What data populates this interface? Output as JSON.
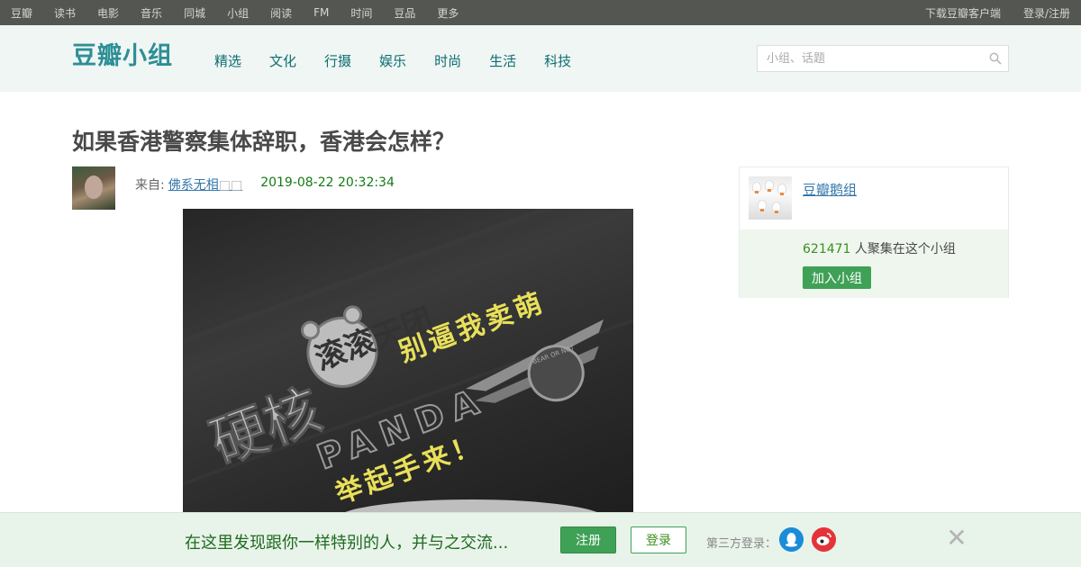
{
  "global_nav": {
    "left": [
      "豆瓣",
      "读书",
      "电影",
      "音乐",
      "同城",
      "小组",
      "阅读",
      "FM",
      "时间",
      "豆品",
      "更多"
    ],
    "right": [
      "下载豆瓣客户端",
      "登录/注册"
    ]
  },
  "header": {
    "logo": "豆瓣小组",
    "nav": [
      "精选",
      "文化",
      "行摄",
      "娱乐",
      "时尚",
      "生活",
      "科技"
    ],
    "search_placeholder": "小组、话题"
  },
  "article": {
    "title": "如果香港警察集体辞职，香港会怎样？",
    "from_label": "来自:",
    "author": "佛系无相",
    "author_suffix": "□□",
    "time": "2019-08-22 20:32:34",
    "image_text": {
      "line1": "滚滚天团",
      "line2": "硬核",
      "line3": "PANDA",
      "line4": "别逼我卖萌",
      "line5": "举起手来！",
      "badge": "BEAR OR NOT"
    }
  },
  "group_card": {
    "name": "豆瓣鹅组",
    "member_count": "621471",
    "member_text": " 人聚集在这个小组",
    "join_label": "加入小组"
  },
  "banner": {
    "text": "在这里发现跟你一样特别的人，并与之交流...",
    "register_label": "注册",
    "login_label": "登录",
    "third_party_label": "第三方登录：",
    "close_glyph": "✕"
  },
  "colors": {
    "brand_green": "#3fa156",
    "logo_teal": "#2d8f96",
    "link_blue": "#3377aa",
    "top_bar": "#545652"
  }
}
